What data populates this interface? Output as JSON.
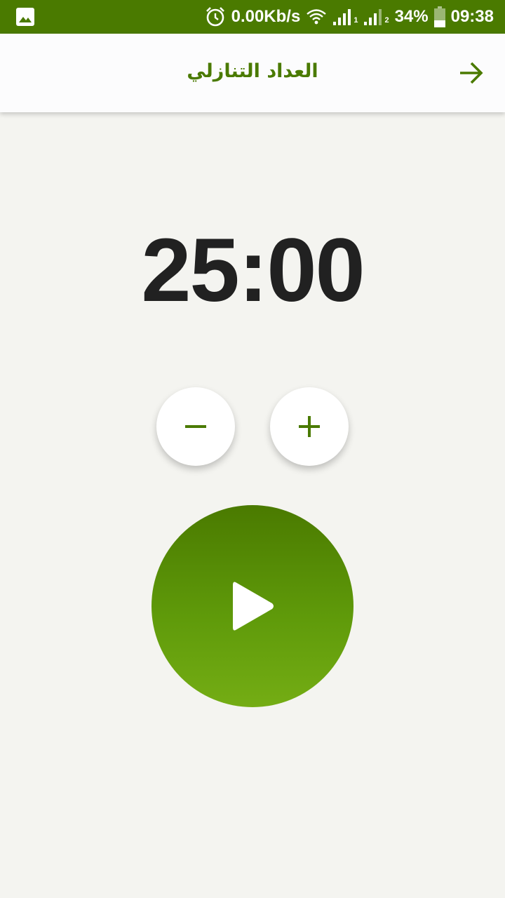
{
  "status_bar": {
    "network_speed": "0.00Kb/s",
    "sim1_label": "1",
    "sim2_label": "2",
    "battery": "34%",
    "time": "09:38",
    "icons": [
      "image-icon",
      "alarm-icon",
      "wifi-icon",
      "signal-icon",
      "battery-icon"
    ]
  },
  "header": {
    "title": "العداد التنازلي",
    "back_icon": "arrow-right-icon"
  },
  "timer": {
    "display": "25:00"
  },
  "controls": {
    "decrease_icon": "minus-icon",
    "increase_icon": "plus-icon",
    "play_icon": "play-icon"
  },
  "colors": {
    "primary": "#4a7a00",
    "primary_light": "#74ad14",
    "background": "#f4f4f0",
    "timer_text": "#212121"
  }
}
